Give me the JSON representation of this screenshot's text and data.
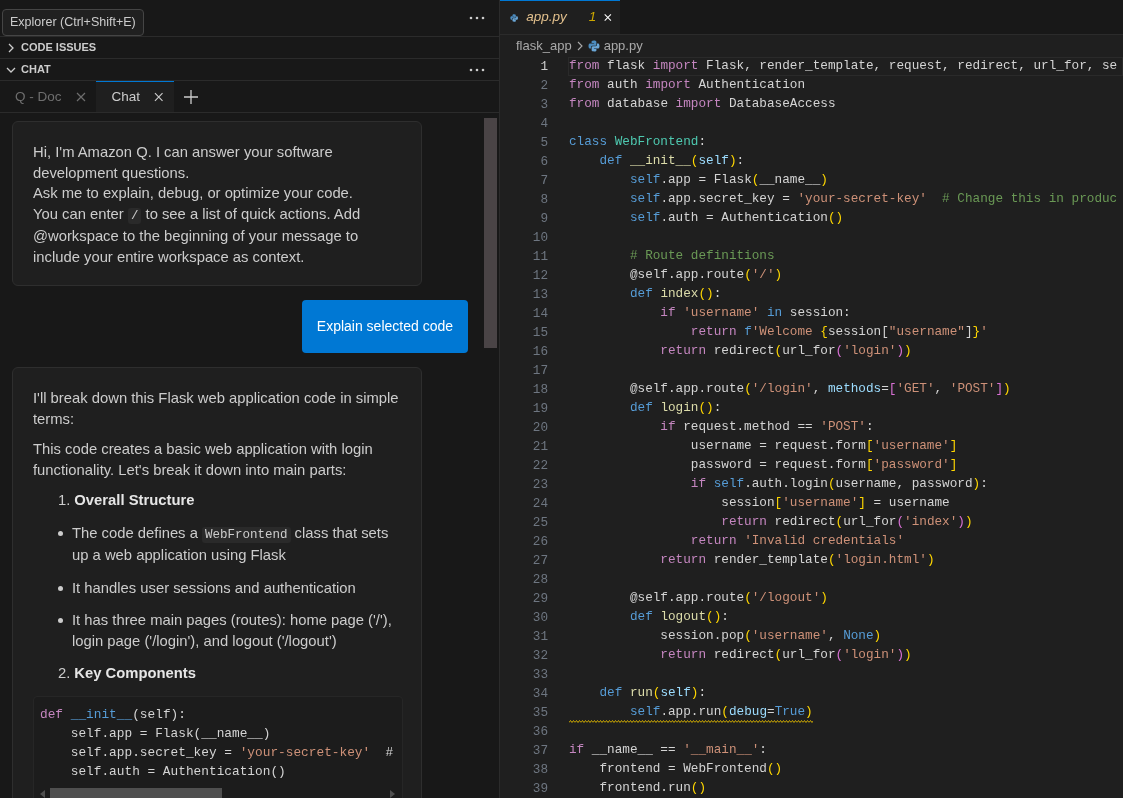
{
  "sidebar": {
    "tooltip": "Explorer (Ctrl+Shift+E)",
    "sections": [
      {
        "title": "CODE ISSUES",
        "expanded": false
      },
      {
        "title": "CHAT",
        "expanded": true
      }
    ],
    "chat_tabs": [
      {
        "label": "Q - Doc",
        "selected": false
      },
      {
        "label": "Chat",
        "selected": true
      }
    ],
    "messages": [
      {
        "kind": "welcome",
        "blocks": [
          {
            "kind": "paragraph",
            "text": "Hi, I'm Amazon Q. I can answer your software development questions."
          },
          {
            "kind": "paragraph",
            "text": "Ask me to explain, debug, or optimize your code."
          },
          {
            "kind": "paragraph",
            "parts": [
              {
                "kind": "text",
                "text": "You can enter "
              },
              {
                "kind": "code",
                "text": "/"
              },
              {
                "kind": "text",
                "text": " to see a list of quick actions. Add @workspace to the beginning of your message to include your entire workspace as context."
              }
            ]
          }
        ]
      },
      {
        "kind": "user",
        "text": "Explain selected code"
      },
      {
        "kind": "answer",
        "blocks": [
          {
            "kind": "paragraph",
            "text": "I'll break down this Flask web application code in simple terms:"
          },
          {
            "kind": "paragraph",
            "text": "This code creates a basic web application with login functionality. Let's break it down into main parts:"
          },
          {
            "kind": "heading",
            "number": "1.",
            "text": "Overall Structure"
          },
          {
            "kind": "bullet",
            "parts": [
              {
                "kind": "text",
                "text": "The code defines a "
              },
              {
                "kind": "code",
                "text": "WebFrontend"
              },
              {
                "kind": "text",
                "text": " class that sets up a web application using Flask"
              }
            ]
          },
          {
            "kind": "bullet",
            "text": "It handles user sessions and authentication"
          },
          {
            "kind": "bullet",
            "text": "It has three main pages (routes): home page ('/'), login page ('/login'), and logout ('/logout')"
          },
          {
            "kind": "heading",
            "number": "2.",
            "text": "Key Components"
          },
          {
            "kind": "code_block",
            "lines": [
              {
                "tokens": [
                  {
                    "text": "def",
                    "kind": "control"
                  },
                  {
                    "text": " __init__",
                    "kind": "storage"
                  },
                  {
                    "text": "(self):",
                    "kind": "plain"
                  }
                ]
              },
              {
                "tokens": [
                  {
                    "text": "    self.app = Flask(__name__)",
                    "kind": "plain"
                  }
                ]
              },
              {
                "tokens": [
                  {
                    "text": "    self.app.secret_key = ",
                    "kind": "plain"
                  },
                  {
                    "text": "'your-secret-key'",
                    "kind": "string"
                  },
                  {
                    "text": "  #",
                    "kind": "plain"
                  }
                ]
              },
              {
                "tokens": [
                  {
                    "text": "    self.auth = Authentication()",
                    "kind": "plain"
                  }
                ]
              }
            ]
          }
        ]
      }
    ]
  },
  "editor": {
    "tabs": [
      {
        "label": "app.py",
        "problems": "1",
        "preview": true,
        "selected": true
      }
    ],
    "breadcrumb": [
      "flask_app",
      "app.py"
    ],
    "lines": [
      {
        "n": "1",
        "current": true,
        "warning": false,
        "tokens": [
          {
            "text": "from",
            "kind": "control"
          },
          {
            "text": " flask ",
            "kind": "plain"
          },
          {
            "text": "import",
            "kind": "control"
          },
          {
            "text": " Flask, render_template, request, redirect, url_for, se",
            "kind": "plain"
          }
        ]
      },
      {
        "n": "2",
        "current": false,
        "warning": false,
        "tokens": [
          {
            "text": "from",
            "kind": "control"
          },
          {
            "text": " auth ",
            "kind": "plain"
          },
          {
            "text": "import",
            "kind": "control"
          },
          {
            "text": " Authentication",
            "kind": "plain"
          }
        ]
      },
      {
        "n": "3",
        "current": false,
        "warning": false,
        "tokens": [
          {
            "text": "from",
            "kind": "control"
          },
          {
            "text": " database ",
            "kind": "plain"
          },
          {
            "text": "import",
            "kind": "control"
          },
          {
            "text": " DatabaseAccess",
            "kind": "plain"
          }
        ]
      },
      {
        "n": "4",
        "current": false
      },
      {
        "n": "5",
        "current": false,
        "warning": false,
        "tokens": [
          {
            "text": "class",
            "kind": "storage"
          },
          {
            "text": " WebFrontend",
            "kind": "type"
          },
          {
            "text": ":",
            "kind": "plain"
          }
        ]
      },
      {
        "n": "6",
        "current": false,
        "warning": false,
        "tokens": [
          {
            "text": "    def",
            "kind": "storage"
          },
          {
            "text": " __init__",
            "kind": "function"
          },
          {
            "text": "(",
            "kind": "bracket"
          },
          {
            "text": "self",
            "kind": "variable"
          },
          {
            "text": ")",
            "kind": "bracket"
          },
          {
            "text": ":",
            "kind": "plain"
          }
        ]
      },
      {
        "n": "7",
        "current": false,
        "warning": false,
        "tokens": [
          {
            "text": "        self",
            "kind": "storage"
          },
          {
            "text": ".app = Flask",
            "kind": "plain"
          },
          {
            "text": "(",
            "kind": "bracket"
          },
          {
            "text": "__name__",
            "kind": "plain"
          },
          {
            "text": ")",
            "kind": "bracket"
          }
        ]
      },
      {
        "n": "8",
        "current": false,
        "warning": false,
        "tokens": [
          {
            "text": "        self",
            "kind": "storage"
          },
          {
            "text": ".app.secret_key = ",
            "kind": "plain"
          },
          {
            "text": "'your-secret-key'",
            "kind": "string"
          },
          {
            "text": "  # Change this in produc",
            "kind": "comment"
          }
        ]
      },
      {
        "n": "9",
        "current": false,
        "warning": false,
        "tokens": [
          {
            "text": "        self",
            "kind": "storage"
          },
          {
            "text": ".auth = Authentication",
            "kind": "plain"
          },
          {
            "text": "()",
            "kind": "bracket"
          }
        ]
      },
      {
        "n": "10",
        "current": false
      },
      {
        "n": "11",
        "current": false,
        "warning": false,
        "tokens": [
          {
            "text": "        # Route definitions",
            "kind": "comment"
          }
        ]
      },
      {
        "n": "12",
        "current": false,
        "warning": false,
        "tokens": [
          {
            "text": "        @self.app.route",
            "kind": "plain"
          },
          {
            "text": "(",
            "kind": "bracket"
          },
          {
            "text": "'/'",
            "kind": "string"
          },
          {
            "text": ")",
            "kind": "bracket"
          }
        ]
      },
      {
        "n": "13",
        "current": false,
        "warning": false,
        "tokens": [
          {
            "text": "        def",
            "kind": "storage"
          },
          {
            "text": " index",
            "kind": "function"
          },
          {
            "text": "()",
            "kind": "bracket"
          },
          {
            "text": ":",
            "kind": "plain"
          }
        ]
      },
      {
        "n": "14",
        "current": false,
        "warning": false,
        "tokens": [
          {
            "text": "            if",
            "kind": "control"
          },
          {
            "text": " 'username'",
            "kind": "string"
          },
          {
            "text": " in",
            "kind": "storage"
          },
          {
            "text": " session:",
            "kind": "plain"
          }
        ]
      },
      {
        "n": "15",
        "current": false,
        "warning": false,
        "tokens": [
          {
            "text": "                return",
            "kind": "control"
          },
          {
            "text": " f",
            "kind": "storage"
          },
          {
            "text": "'Welcome ",
            "kind": "string"
          },
          {
            "text": "{",
            "kind": "bracket"
          },
          {
            "text": "session[",
            "kind": "plain"
          },
          {
            "text": "\"username\"",
            "kind": "string"
          },
          {
            "text": "]",
            "kind": "plain"
          },
          {
            "text": "}",
            "kind": "bracket"
          },
          {
            "text": "'",
            "kind": "string"
          }
        ]
      },
      {
        "n": "16",
        "current": false,
        "warning": false,
        "tokens": [
          {
            "text": "            return",
            "kind": "control"
          },
          {
            "text": " redirect",
            "kind": "plain"
          },
          {
            "text": "(",
            "kind": "bracket"
          },
          {
            "text": "url_for",
            "kind": "plain"
          },
          {
            "text": "(",
            "kind": "bracket2"
          },
          {
            "text": "'login'",
            "kind": "string"
          },
          {
            "text": ")",
            "kind": "bracket2"
          },
          {
            "text": ")",
            "kind": "bracket"
          }
        ]
      },
      {
        "n": "17",
        "current": false
      },
      {
        "n": "18",
        "current": false,
        "warning": false,
        "tokens": [
          {
            "text": "        @self.app.route",
            "kind": "plain"
          },
          {
            "text": "(",
            "kind": "bracket"
          },
          {
            "text": "'/login'",
            "kind": "string"
          },
          {
            "text": ", ",
            "kind": "plain"
          },
          {
            "text": "methods",
            "kind": "variable"
          },
          {
            "text": "=",
            "kind": "plain"
          },
          {
            "text": "[",
            "kind": "bracket2"
          },
          {
            "text": "'GET'",
            "kind": "string"
          },
          {
            "text": ", ",
            "kind": "plain"
          },
          {
            "text": "'POST'",
            "kind": "string"
          },
          {
            "text": "]",
            "kind": "bracket2"
          },
          {
            "text": ")",
            "kind": "bracket"
          }
        ]
      },
      {
        "n": "19",
        "current": false,
        "warning": false,
        "tokens": [
          {
            "text": "        def",
            "kind": "storage"
          },
          {
            "text": " login",
            "kind": "function"
          },
          {
            "text": "()",
            "kind": "bracket"
          },
          {
            "text": ":",
            "kind": "plain"
          }
        ]
      },
      {
        "n": "20",
        "current": false,
        "warning": false,
        "tokens": [
          {
            "text": "            if",
            "kind": "control"
          },
          {
            "text": " request.method == ",
            "kind": "plain"
          },
          {
            "text": "'POST'",
            "kind": "string"
          },
          {
            "text": ":",
            "kind": "plain"
          }
        ]
      },
      {
        "n": "21",
        "current": false,
        "warning": false,
        "tokens": [
          {
            "text": "                username = request.form",
            "kind": "plain"
          },
          {
            "text": "[",
            "kind": "bracket"
          },
          {
            "text": "'username'",
            "kind": "string"
          },
          {
            "text": "]",
            "kind": "bracket"
          }
        ]
      },
      {
        "n": "22",
        "current": false,
        "warning": false,
        "tokens": [
          {
            "text": "                password = request.form",
            "kind": "plain"
          },
          {
            "text": "[",
            "kind": "bracket"
          },
          {
            "text": "'password'",
            "kind": "string"
          },
          {
            "text": "]",
            "kind": "bracket"
          }
        ]
      },
      {
        "n": "23",
        "current": false,
        "warning": false,
        "tokens": [
          {
            "text": "                if",
            "kind": "control"
          },
          {
            "text": " self",
            "kind": "storage"
          },
          {
            "text": ".auth.login",
            "kind": "plain"
          },
          {
            "text": "(",
            "kind": "bracket"
          },
          {
            "text": "username, password",
            "kind": "plain"
          },
          {
            "text": ")",
            "kind": "bracket"
          },
          {
            "text": ":",
            "kind": "plain"
          }
        ]
      },
      {
        "n": "24",
        "current": false,
        "warning": false,
        "tokens": [
          {
            "text": "                    session",
            "kind": "plain"
          },
          {
            "text": "[",
            "kind": "bracket"
          },
          {
            "text": "'username'",
            "kind": "string"
          },
          {
            "text": "]",
            "kind": "bracket"
          },
          {
            "text": " = username",
            "kind": "plain"
          }
        ]
      },
      {
        "n": "25",
        "current": false,
        "warning": false,
        "tokens": [
          {
            "text": "                    return",
            "kind": "control"
          },
          {
            "text": " redirect",
            "kind": "plain"
          },
          {
            "text": "(",
            "kind": "bracket"
          },
          {
            "text": "url_for",
            "kind": "plain"
          },
          {
            "text": "(",
            "kind": "bracket2"
          },
          {
            "text": "'index'",
            "kind": "string"
          },
          {
            "text": ")",
            "kind": "bracket2"
          },
          {
            "text": ")",
            "kind": "bracket"
          }
        ]
      },
      {
        "n": "26",
        "current": false,
        "warning": false,
        "tokens": [
          {
            "text": "                return",
            "kind": "control"
          },
          {
            "text": " 'Invalid credentials'",
            "kind": "string"
          }
        ]
      },
      {
        "n": "27",
        "current": false,
        "warning": false,
        "tokens": [
          {
            "text": "            return",
            "kind": "control"
          },
          {
            "text": " render_template",
            "kind": "plain"
          },
          {
            "text": "(",
            "kind": "bracket"
          },
          {
            "text": "'login.html'",
            "kind": "string"
          },
          {
            "text": ")",
            "kind": "bracket"
          }
        ]
      },
      {
        "n": "28",
        "current": false
      },
      {
        "n": "29",
        "current": false,
        "warning": false,
        "tokens": [
          {
            "text": "        @self.app.route",
            "kind": "plain"
          },
          {
            "text": "(",
            "kind": "bracket"
          },
          {
            "text": "'/logout'",
            "kind": "string"
          },
          {
            "text": ")",
            "kind": "bracket"
          }
        ]
      },
      {
        "n": "30",
        "current": false,
        "warning": false,
        "tokens": [
          {
            "text": "        def",
            "kind": "storage"
          },
          {
            "text": " logout",
            "kind": "function"
          },
          {
            "text": "()",
            "kind": "bracket"
          },
          {
            "text": ":",
            "kind": "plain"
          }
        ]
      },
      {
        "n": "31",
        "current": false,
        "warning": false,
        "tokens": [
          {
            "text": "            session.pop",
            "kind": "plain"
          },
          {
            "text": "(",
            "kind": "bracket"
          },
          {
            "text": "'username'",
            "kind": "string"
          },
          {
            "text": ", ",
            "kind": "plain"
          },
          {
            "text": "None",
            "kind": "storage"
          },
          {
            "text": ")",
            "kind": "bracket"
          }
        ]
      },
      {
        "n": "32",
        "current": false,
        "warning": false,
        "tokens": [
          {
            "text": "            return",
            "kind": "control"
          },
          {
            "text": " redirect",
            "kind": "plain"
          },
          {
            "text": "(",
            "kind": "bracket"
          },
          {
            "text": "url_for",
            "kind": "plain"
          },
          {
            "text": "(",
            "kind": "bracket2"
          },
          {
            "text": "'login'",
            "kind": "string"
          },
          {
            "text": ")",
            "kind": "bracket2"
          },
          {
            "text": ")",
            "kind": "bracket"
          }
        ]
      },
      {
        "n": "33",
        "current": false
      },
      {
        "n": "34",
        "current": false,
        "warning": false,
        "tokens": [
          {
            "text": "    def",
            "kind": "storage"
          },
          {
            "text": " run",
            "kind": "function"
          },
          {
            "text": "(",
            "kind": "bracket"
          },
          {
            "text": "self",
            "kind": "variable"
          },
          {
            "text": ")",
            "kind": "bracket"
          },
          {
            "text": ":",
            "kind": "plain"
          }
        ]
      },
      {
        "n": "35",
        "current": false,
        "warning": true,
        "tokens": [
          {
            "text": "        self",
            "kind": "storage"
          },
          {
            "text": ".app.run",
            "kind": "plain"
          },
          {
            "text": "(",
            "kind": "bracket"
          },
          {
            "text": "debug",
            "kind": "variable"
          },
          {
            "text": "=",
            "kind": "plain"
          },
          {
            "text": "True",
            "kind": "storage"
          },
          {
            "text": ")",
            "kind": "bracket"
          }
        ]
      },
      {
        "n": "36",
        "current": false
      },
      {
        "n": "37",
        "current": false,
        "warning": false,
        "tokens": [
          {
            "text": "if",
            "kind": "control"
          },
          {
            "text": " __name__ == ",
            "kind": "plain"
          },
          {
            "text": "'__main__'",
            "kind": "string"
          },
          {
            "text": ":",
            "kind": "plain"
          }
        ]
      },
      {
        "n": "38",
        "current": false,
        "warning": false,
        "tokens": [
          {
            "text": "    frontend = WebFrontend",
            "kind": "plain"
          },
          {
            "text": "()",
            "kind": "bracket"
          }
        ]
      },
      {
        "n": "39",
        "current": false,
        "warning": false,
        "tokens": [
          {
            "text": "    frontend.run",
            "kind": "plain"
          },
          {
            "text": "()",
            "kind": "bracket"
          }
        ]
      }
    ]
  }
}
